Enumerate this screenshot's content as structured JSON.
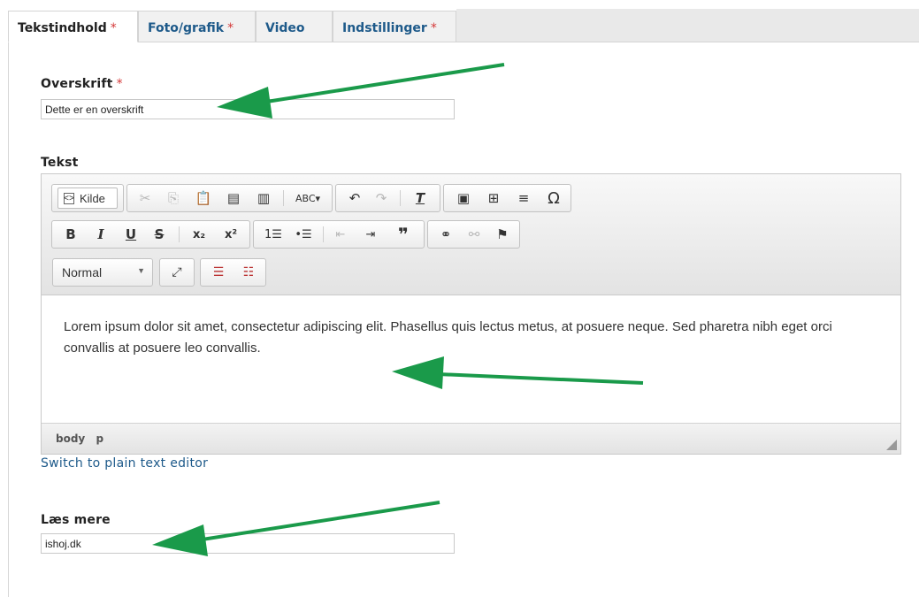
{
  "tabs": [
    {
      "label": "Tekstindhold",
      "required": "*"
    },
    {
      "label": "Foto/grafik",
      "required": "*"
    },
    {
      "label": "Video",
      "required": ""
    },
    {
      "label": "Indstillinger",
      "required": "*"
    }
  ],
  "overskrift": {
    "label": "Overskrift",
    "required": "*",
    "value": "Dette er en overskrift"
  },
  "tekst": {
    "label": "Tekst",
    "toolbar": {
      "source_label": "Kilde",
      "format_value": "Normal"
    },
    "content": "Lorem ipsum dolor sit amet, consectetur adipiscing elit. Phasellus quis lectus metus, at posuere neque. Sed pharetra nibh eget orci convallis at posuere leo convallis.",
    "path": [
      "body",
      "p"
    ]
  },
  "switch_link": "Switch to plain text editor",
  "laes_mere": {
    "label": "Læs mere",
    "value": "ishoj.dk"
  },
  "colors": {
    "arrow": "#1a9a4a",
    "tab_link": "#1e5a8a",
    "required": "#d43838"
  }
}
